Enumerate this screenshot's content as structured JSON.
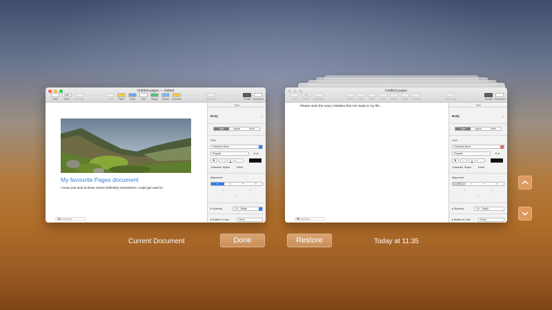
{
  "left_window": {
    "title": "Untitled.pages — Edited",
    "doc_heading": "My favourite Pages document",
    "doc_body": "I mean just look at those views! Definitely somewhere I could get used to.",
    "status_count": "101",
    "status_label": "characters"
  },
  "right_window": {
    "title": "Untitled.pages",
    "doc_body": "Please undo the many mistakes that I've made in my life...",
    "status_count": "56",
    "status_label": "characters"
  },
  "toolbar": {
    "view": "View",
    "zoom": "Zoom",
    "zoom_value": "125%",
    "add_page": "Add Page",
    "insert": "Insert",
    "table": "Table",
    "chart": "Chart",
    "text": "Text",
    "shape": "Shape",
    "media": "Media",
    "comment": "Comment",
    "collaborate": "Collaborate",
    "format": "Format",
    "document": "Document"
  },
  "inspector": {
    "top_tab": "Text",
    "paragraph_style": "Body",
    "seg_style": "Style",
    "seg_layout": "Layout",
    "seg_more": "More",
    "font_label": "Font",
    "font_name": "Helvetica Neue",
    "font_weight": "Regular",
    "font_size": "11 pt",
    "bold": "B",
    "italic": "I",
    "underline": "U",
    "char_styles_label": "Character Styles",
    "char_styles_value": "None",
    "alignment_label": "Alignment",
    "spacing_label": "Spacing",
    "spacing_value": "1.0 - Single",
    "bullets_label": "Bullets & Lists",
    "bullets_value": "None"
  },
  "timemachine": {
    "current_label": "Current Document",
    "done_label": "Done",
    "restore_label": "Restore",
    "version_time": "Today at 11:35"
  },
  "icons": {
    "up": "chevron-up-icon",
    "down": "chevron-down-icon"
  },
  "colors": {
    "heading_blue": "#2f7fd4",
    "traffic_red": "#fc5f57",
    "traffic_yellow": "#fdbc2e",
    "traffic_green": "#28c840"
  }
}
